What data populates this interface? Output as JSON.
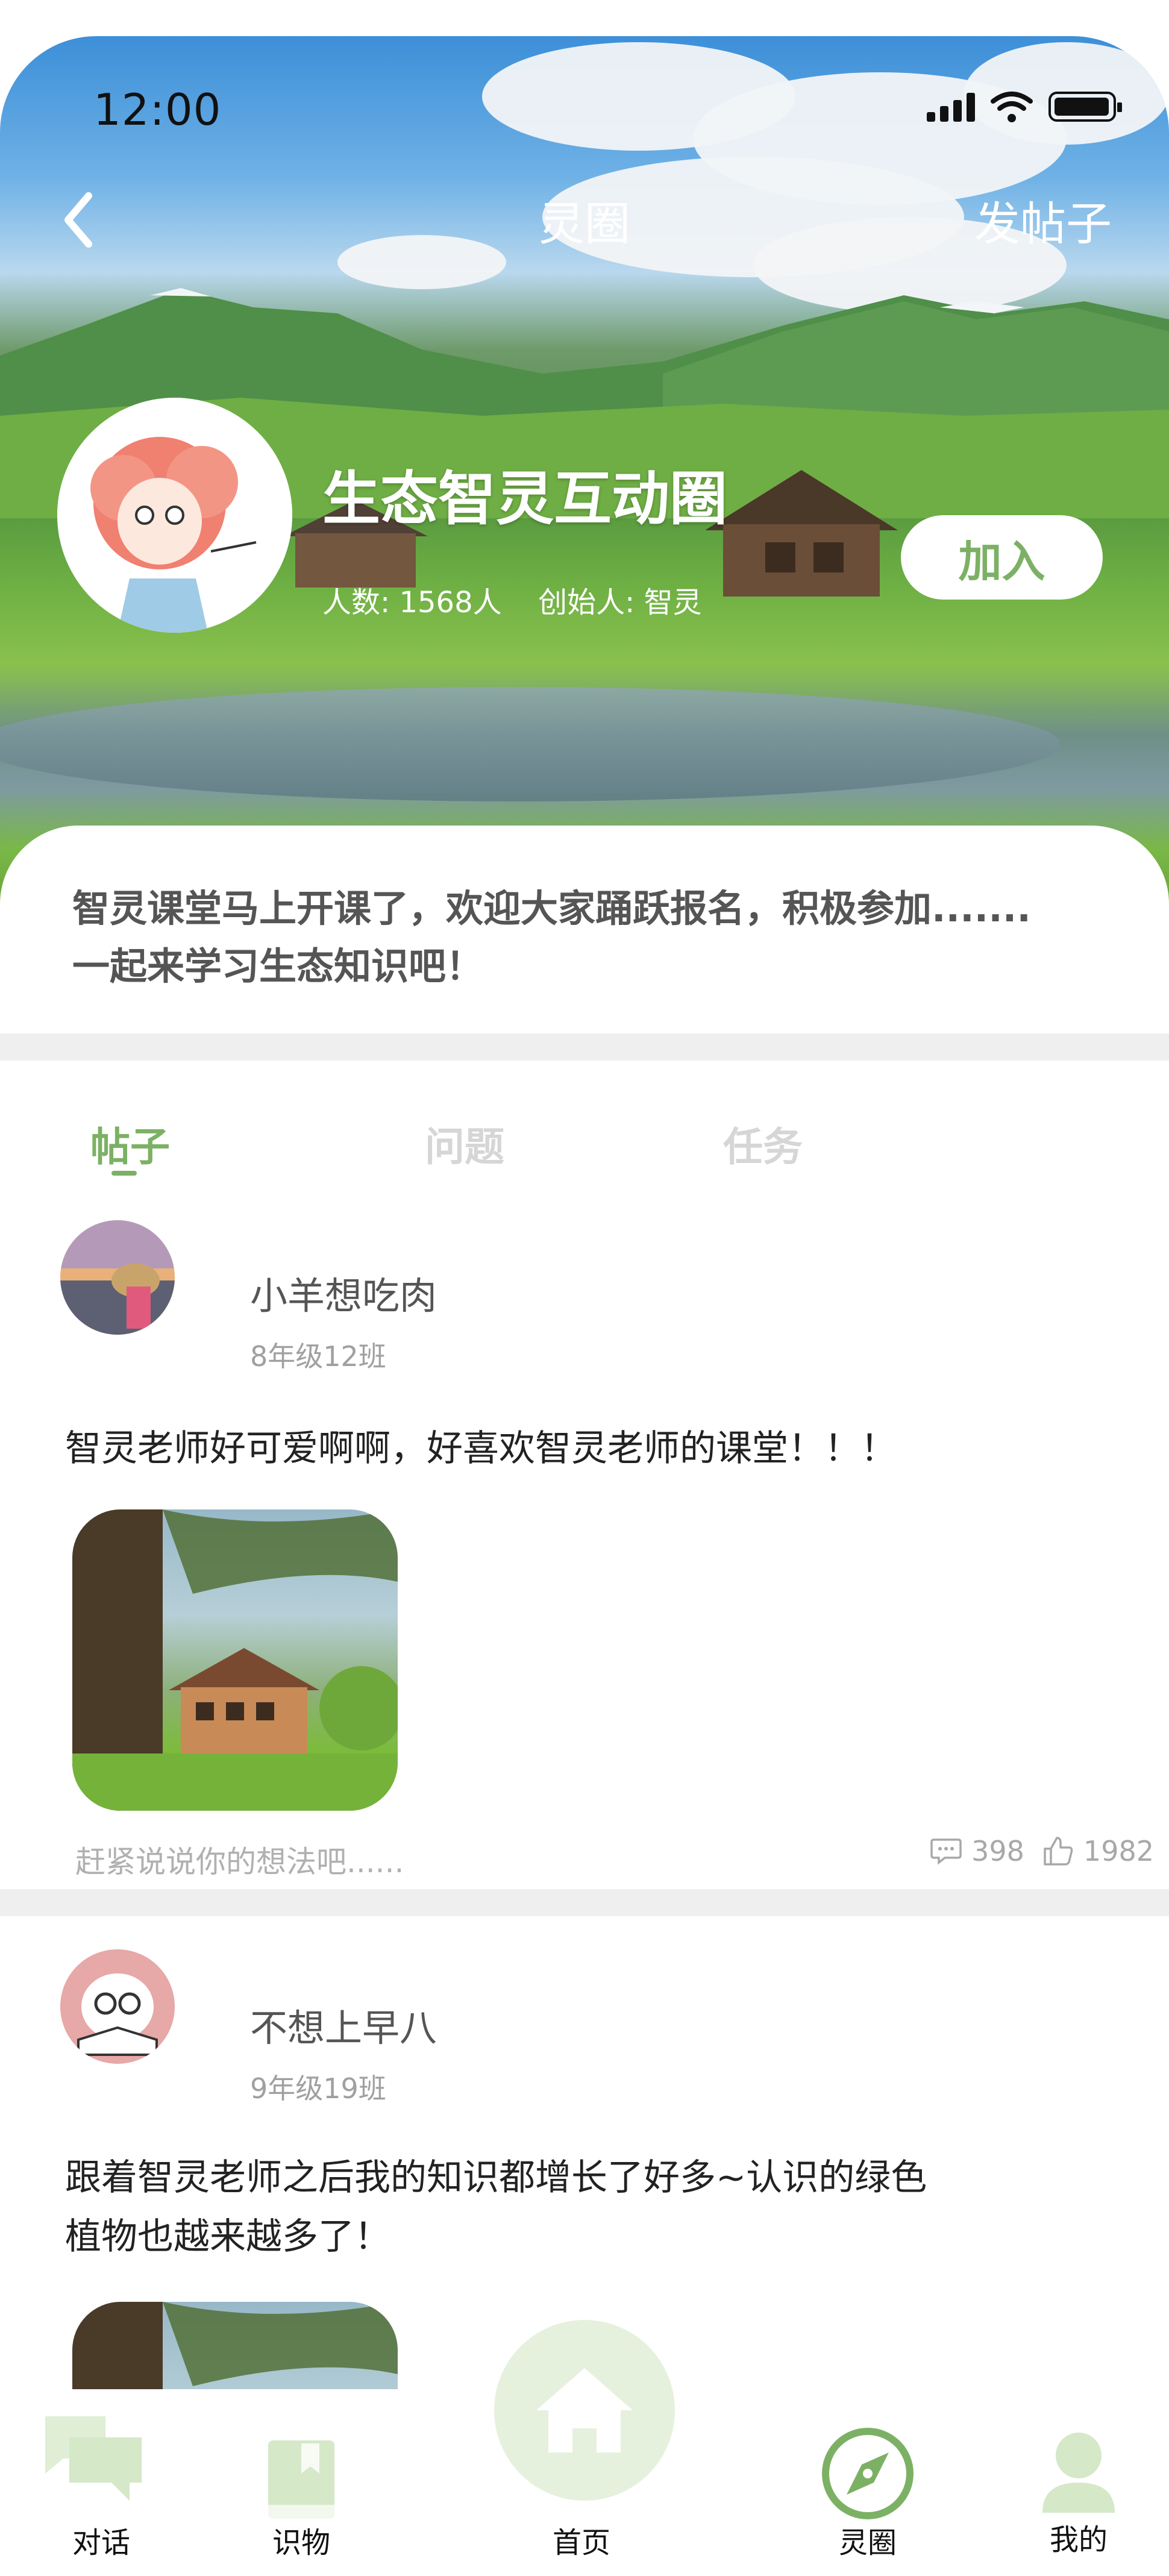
{
  "status_bar": {
    "time": "12:00"
  },
  "header": {
    "title": "灵圈",
    "post_button": "发帖子"
  },
  "circle": {
    "name": "生态智灵互动圈",
    "member_label": "人数:",
    "member_count": "1568人",
    "creator_label": "创始人:",
    "creator_name": "智灵",
    "join_label": "加入"
  },
  "announcement": {
    "line1": "智灵课堂马上开课了，欢迎大家踊跃报名，积极参加.......",
    "line2": "一起来学习生态知识吧！"
  },
  "tabs": [
    {
      "label": "帖子",
      "active": true
    },
    {
      "label": "问题",
      "active": false
    },
    {
      "label": "任务",
      "active": false
    }
  ],
  "posts": [
    {
      "author": "小羊想吃肉",
      "class": "8年级12班",
      "text_lines": [
        "智灵老师好可爱啊啊，好喜欢智灵老师的课堂！！！"
      ],
      "comment_placeholder": "赶紧说说你的想法吧......",
      "comments": "398",
      "likes": "1982"
    },
    {
      "author": "不想上早八",
      "class": "9年级19班",
      "text_lines": [
        "跟着智灵老师之后我的知识都增长了好多~认识的绿色",
        "植物也越来越多了！"
      ]
    }
  ],
  "bottom_nav": [
    {
      "label": "对话",
      "icon": "chat-icon"
    },
    {
      "label": "识物",
      "icon": "book-icon"
    },
    {
      "label": "首页",
      "icon": "home-icon"
    },
    {
      "label": "灵圈",
      "icon": "compass-icon",
      "active": true
    },
    {
      "label": "我的",
      "icon": "user-icon"
    }
  ],
  "colors": {
    "accent": "#7cb165",
    "light_accent": "#e6f1dd",
    "separator": "#efefef"
  }
}
